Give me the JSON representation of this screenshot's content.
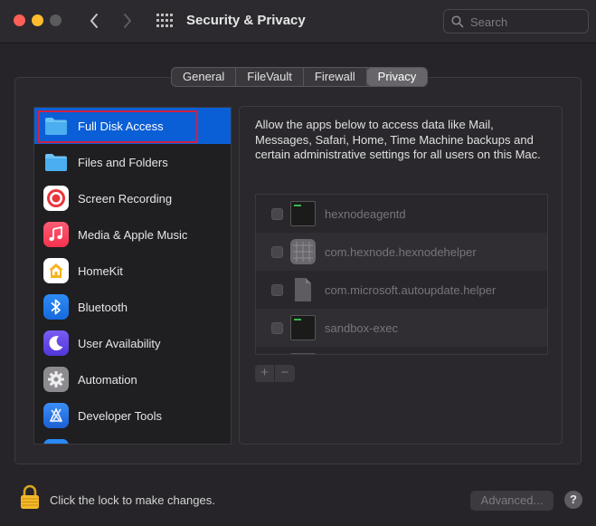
{
  "window": {
    "title": "Security & Privacy",
    "search_placeholder": "Search"
  },
  "tabs": [
    {
      "label": "General",
      "active": false
    },
    {
      "label": "FileVault",
      "active": false
    },
    {
      "label": "Firewall",
      "active": false
    },
    {
      "label": "Privacy",
      "active": true
    }
  ],
  "sidebar": {
    "items": [
      {
        "label": "Full Disk Access",
        "icon": "folder-icon",
        "selected": true
      },
      {
        "label": "Files and Folders",
        "icon": "folder-icon"
      },
      {
        "label": "Screen Recording",
        "icon": "screen-recording-icon"
      },
      {
        "label": "Media & Apple Music",
        "icon": "music-note-icon"
      },
      {
        "label": "HomeKit",
        "icon": "homekit-icon"
      },
      {
        "label": "Bluetooth",
        "icon": "bluetooth-icon"
      },
      {
        "label": "User Availability",
        "icon": "moon-icon"
      },
      {
        "label": "Automation",
        "icon": "gear-icon"
      },
      {
        "label": "Developer Tools",
        "icon": "developer-tools-icon"
      }
    ]
  },
  "content": {
    "description": "Allow the apps below to access data like Mail, Messages, Safari, Home, Time Machine backups and certain administrative settings for all users on this Mac.",
    "apps": [
      {
        "name": "hexnodeagentd",
        "icon": "terminal-icon",
        "checked": false
      },
      {
        "name": "com.hexnode.hexnodehelper",
        "icon": "app-grid-icon",
        "checked": false
      },
      {
        "name": "com.microsoft.autoupdate.helper",
        "icon": "document-icon",
        "checked": false
      },
      {
        "name": "sandbox-exec",
        "icon": "terminal-icon",
        "checked": false
      }
    ],
    "add_label": "+",
    "remove_label": "−"
  },
  "footer": {
    "lock_text": "Click the lock to make changes.",
    "advanced_label": "Advanced...",
    "help_label": "?"
  },
  "colors": {
    "selection": "#0b5fd6",
    "close": "#fe5f57",
    "minimize": "#febc2e"
  }
}
